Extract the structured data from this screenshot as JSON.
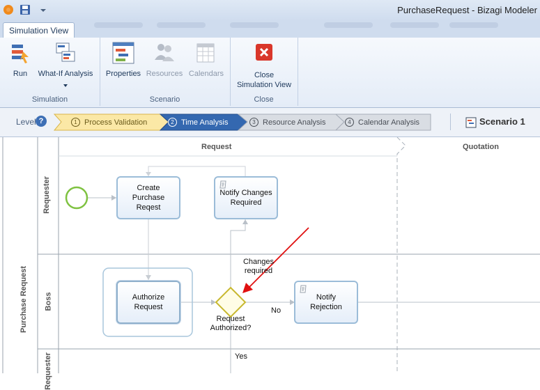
{
  "window": {
    "title": "PurchaseRequest - Bizagi Modeler"
  },
  "ribbon": {
    "active_tab": "Simulation View",
    "groups": {
      "simulation": {
        "label": "Simulation",
        "run": "Run",
        "whatif": "What-If Analysis"
      },
      "scenario": {
        "label": "Scenario",
        "properties": "Properties",
        "resources": "Resources",
        "calendars": "Calendars"
      },
      "close": {
        "label": "Close",
        "close_line1": "Close",
        "close_line2": "Simulation View"
      }
    }
  },
  "levels": {
    "label": "Level",
    "help": "?",
    "steps": [
      {
        "num": "1",
        "label": "Process Validation",
        "state": "done"
      },
      {
        "num": "2",
        "label": "Time Analysis",
        "state": "active"
      },
      {
        "num": "3",
        "label": "Resource Analysis",
        "state": "todo"
      },
      {
        "num": "4",
        "label": "Calendar Analysis",
        "state": "todo"
      }
    ],
    "scenario": "Scenario 1"
  },
  "diagram": {
    "pool": "Purchase Request",
    "lanes": [
      "Requester",
      "Boss",
      "Requester"
    ],
    "phases": [
      "Request",
      "Quotation"
    ],
    "tasks": {
      "create": [
        "Create",
        "Purchase",
        "Reqest"
      ],
      "notify_changes": [
        "Notify Changes",
        "Required"
      ],
      "authorize": [
        "Authorize",
        "Request"
      ],
      "notify_rejection": [
        "Notify",
        "Rejection"
      ]
    },
    "gateway": [
      "Request",
      "Authorized?"
    ],
    "flows": {
      "changes": [
        "Changes",
        "required"
      ],
      "no": "No",
      "yes": "Yes"
    }
  },
  "colors": {
    "active_step": "#3468b0",
    "done_step": "#fbe8a6",
    "annotation_arrow": "#e01010",
    "start_event": "#7fc241",
    "gateway": "#d6c93a"
  }
}
